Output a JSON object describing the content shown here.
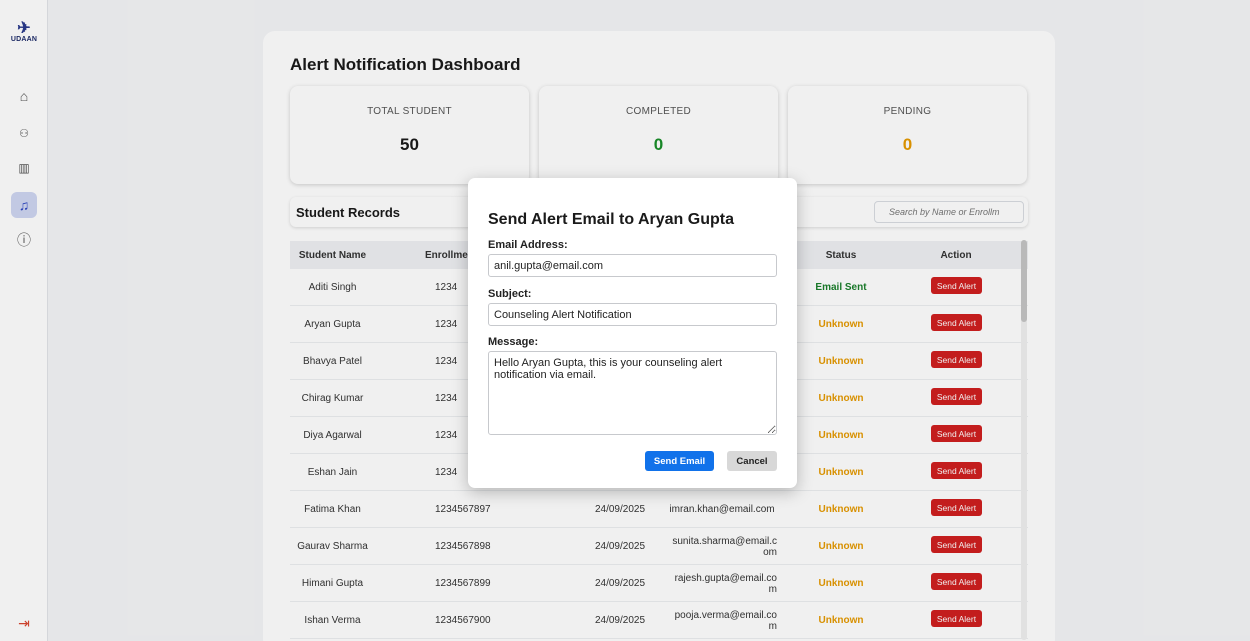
{
  "sidebar": {
    "logo_text": "UDAAN",
    "items": [
      {
        "name": "home-icon",
        "glyph": "⌂"
      },
      {
        "name": "users-icon",
        "glyph": "👥"
      },
      {
        "name": "chart-icon",
        "glyph": "📊"
      },
      {
        "name": "bell-icon",
        "glyph": "🔔"
      },
      {
        "name": "info-icon",
        "glyph": "ⓘ"
      }
    ],
    "logout_glyph": "⇥"
  },
  "dashboard": {
    "title": "Alert Notification Dashboard",
    "stats": {
      "total_label": "TOTAL STUDENT",
      "total_value": "50",
      "completed_label": "COMPLETED",
      "completed_value": "0",
      "pending_label": "PENDING",
      "pending_value": "0"
    },
    "records_title": "Student Records",
    "search_placeholder": "Search by Name or Enrollm"
  },
  "table": {
    "headers": {
      "name": "Student Name",
      "enrollment": "Enrollmen",
      "status": "Status",
      "action": "Action"
    },
    "rows": [
      {
        "name": "Aditi Singh",
        "enroll": "1234",
        "date": "",
        "email": "",
        "status": "Email Sent"
      },
      {
        "name": "Aryan Gupta",
        "enroll": "1234",
        "date": "",
        "email": "",
        "status": "Unknown"
      },
      {
        "name": "Bhavya Patel",
        "enroll": "1234",
        "date": "",
        "email": "",
        "status": "Unknown"
      },
      {
        "name": "Chirag Kumar",
        "enroll": "1234",
        "date": "",
        "email": "",
        "status": "Unknown"
      },
      {
        "name": "Diya Agarwal",
        "enroll": "1234",
        "date": "",
        "email": "",
        "status": "Unknown"
      },
      {
        "name": "Eshan Jain",
        "enroll": "1234",
        "date": "",
        "email": "",
        "status": "Unknown"
      },
      {
        "name": "Fatima Khan",
        "enroll": "1234567897",
        "date": "24/09/2025",
        "email": "imran.khan@email.com",
        "status": "Unknown"
      },
      {
        "name": "Gaurav Sharma",
        "enroll": "1234567898",
        "date": "24/09/2025",
        "email": "sunita.sharma@email.c\nom",
        "status": "Unknown"
      },
      {
        "name": "Himani Gupta",
        "enroll": "1234567899",
        "date": "24/09/2025",
        "email": "rajesh.gupta@email.co\nm",
        "status": "Unknown"
      },
      {
        "name": "Ishan Verma",
        "enroll": "1234567900",
        "date": "24/09/2025",
        "email": "pooja.verma@email.co\nm",
        "status": "Unknown"
      }
    ],
    "action_label": "Send Alert",
    "status_colors": {
      "Email Sent": "#1a7f2b",
      "Unknown": "#e69a00"
    }
  },
  "modal": {
    "title": "Send Alert Email to Aryan Gupta",
    "email_label": "Email Address:",
    "email_value": "anil.gupta@email.com",
    "subject_label": "Subject:",
    "subject_value": "Counseling Alert Notification",
    "message_label": "Message:",
    "message_value": "Hello Aryan Gupta, this is your counseling alert notification via email.",
    "send_label": "Send Email",
    "cancel_label": "Cancel"
  },
  "colors": {
    "accent": "#1172ea",
    "danger": "#d01f1f",
    "completed": "#1a8f2a",
    "pending": "#e69a00"
  }
}
